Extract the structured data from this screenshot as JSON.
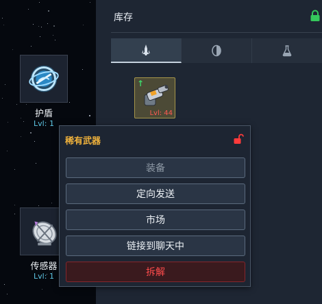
{
  "inventory": {
    "title": "库存",
    "tabs": [
      {
        "icon": "ship-icon",
        "active": true
      },
      {
        "icon": "shield-part-icon",
        "active": false
      },
      {
        "icon": "flask-icon",
        "active": false
      }
    ],
    "items": [
      {
        "icon": "cannon-weapon-icon",
        "level_label": "Lvl: 44",
        "upgrade_indicator": "↑"
      }
    ]
  },
  "skills": [
    {
      "name": "护盾",
      "level": "Lvl: 1",
      "icon": "shield-orbit-icon"
    },
    {
      "name": "传感器",
      "level": "Lvl: 1",
      "icon": "satellite-dish-icon"
    }
  ],
  "popup": {
    "title": "稀有武器",
    "buttons": [
      {
        "label": "装备",
        "state": "disabled"
      },
      {
        "label": "定向发送",
        "state": "normal"
      },
      {
        "label": "市场",
        "state": "normal"
      },
      {
        "label": "链接到聊天中",
        "state": "normal"
      },
      {
        "label": "拆解",
        "state": "danger"
      }
    ]
  },
  "colors": {
    "rarity_title": "#f0b23c",
    "danger": "#ff4c4c",
    "level_text": "#5fc8e6",
    "lock_green": "#35c85c",
    "lock_red": "#ff3b3b"
  }
}
